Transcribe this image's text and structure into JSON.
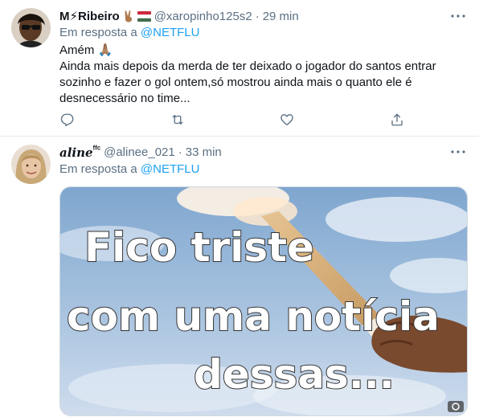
{
  "tweets": [
    {
      "display_name": "M⚡Ribeiro",
      "handle": "@xaropinho125s2",
      "separator": "·",
      "time": "29 min",
      "reply_prefix": "Em resposta a ",
      "reply_to": "@NETFLU",
      "text_line1": "Amém 🙏🏽",
      "text_line2": "Ainda mais depois da merda de ter deixado o jogador do santos entrar sozinho e fazer o gol ontem,só mostrou ainda mais o quanto ele é desnecessário no time..."
    },
    {
      "display_name": "𝒂𝒍𝒊𝒏𝒆",
      "display_name_suffix": "ᶠᶠᶜ",
      "handle": "@alinee_021",
      "separator": "·",
      "time": "33 min",
      "reply_prefix": "Em resposta a ",
      "reply_to": "@NETFLU",
      "media": {
        "meme_line1": "Fico triste",
        "meme_line2": "com uma notícia",
        "meme_line3": "dessas..."
      }
    }
  ],
  "icons": {
    "reply": "reply-icon",
    "retweet": "retweet-icon",
    "like": "like-icon",
    "share": "share-icon",
    "more": "more-icon"
  },
  "colors": {
    "accent": "#1da1f2",
    "secondary_text": "#5b7083",
    "divider": "#e6ecf0"
  }
}
